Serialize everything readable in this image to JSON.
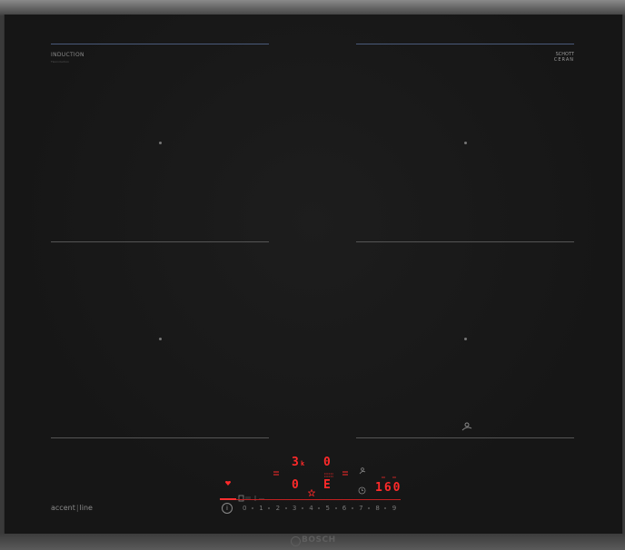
{
  "hob": {
    "brand_small": "INDUCTION",
    "sub_small": "Flexinduction",
    "glass_brand_top": "SCHOTT",
    "glass_brand_bottom": "CERAN",
    "series_left": "accent",
    "series_right": "line",
    "brand": "BOSCH"
  },
  "display": {
    "zone_tl_value": "3",
    "zone_tl_sub": "k",
    "zone_tr_value": "0",
    "zone_bl_value": "0",
    "zone_br_value": "E",
    "timer_value": "160"
  },
  "scale": {
    "info_label": "i",
    "items": [
      "0",
      "1",
      "2",
      "3",
      "4",
      "5",
      "6",
      "7",
      "8",
      "9"
    ]
  },
  "colors": {
    "glass": "#161616",
    "display_red": "#ff2a2a",
    "trim": "#3a3a3a"
  },
  "icons": [
    "heart-icon",
    "fry-sensor-icon",
    "star-icon",
    "clock-icon",
    "pan-icon",
    "flex-icon"
  ]
}
